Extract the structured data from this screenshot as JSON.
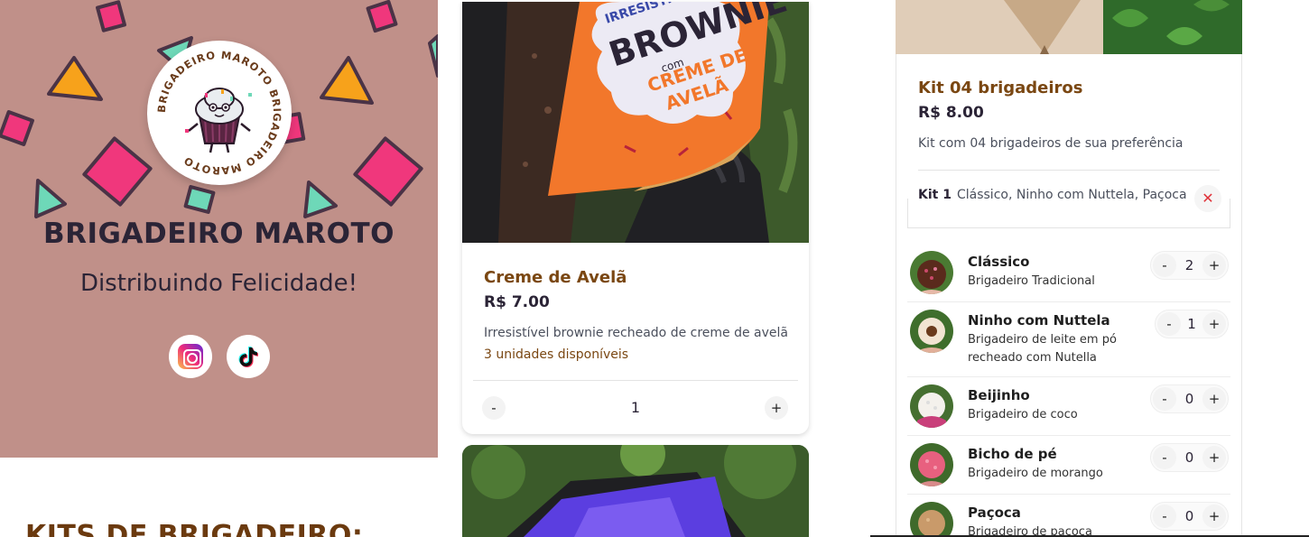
{
  "brand": {
    "name": "BRIGADEIRO MAROTO",
    "tagline": "Distribuindo Felicidade!",
    "logo_ring_text": "BRIGADEIRO MAROTO BRIGADEIRO MAROTO",
    "social": [
      "instagram-icon",
      "tiktok-icon"
    ]
  },
  "sections": {
    "kits_heading": "KITS DE BRIGADEIRO:"
  },
  "product": {
    "package_text": [
      "IRRESISTÍVEL",
      "BROWNIE",
      "com",
      "CREME DE",
      "AVELÃ"
    ],
    "name": "Creme de Avelã",
    "price": "R$ 7.00",
    "description": "Irresistível brownie recheado de creme de avelã",
    "stock": "3 unidades disponíveis",
    "minus": "-",
    "plus": "+",
    "quantity": "1"
  },
  "kit": {
    "title": "Kit 04 brigadeiros",
    "price": "R$ 8.00",
    "description": "Kit com 04 brigadeiros de sua preferência",
    "selection_label": "Kit 1",
    "selection_items": "Clássico, Ninho com Nuttela, Paçoca",
    "remove_icon": "close-icon",
    "remove_symbol": "✕",
    "flavors": [
      {
        "name": "Clássico",
        "description": "Brigadeiro Tradicional",
        "quantity": "2",
        "minus": "-",
        "plus": "+"
      },
      {
        "name": "Ninho com Nuttela",
        "description": "Brigadeiro de leite em pó recheado com Nutella",
        "quantity": "1",
        "minus": "-",
        "plus": "+"
      },
      {
        "name": "Beijinho",
        "description": "Brigadeiro de coco",
        "quantity": "0",
        "minus": "-",
        "plus": "+"
      },
      {
        "name": "Bicho de pé",
        "description": "Brigadeiro de morango",
        "quantity": "0",
        "minus": "-",
        "plus": "+"
      },
      {
        "name": "Paçoca",
        "description": "Brigadeiro de paçoca coberto",
        "quantity": "0",
        "minus": "-",
        "plus": "+"
      }
    ]
  },
  "colors": {
    "hero_bg": "#c09089",
    "accent_brown": "#7a4712",
    "confetti_pink": "#f0377c",
    "confetti_orange": "#f7a21b",
    "confetti_mint": "#6ed8b8",
    "dark_ink": "#2b2436"
  }
}
